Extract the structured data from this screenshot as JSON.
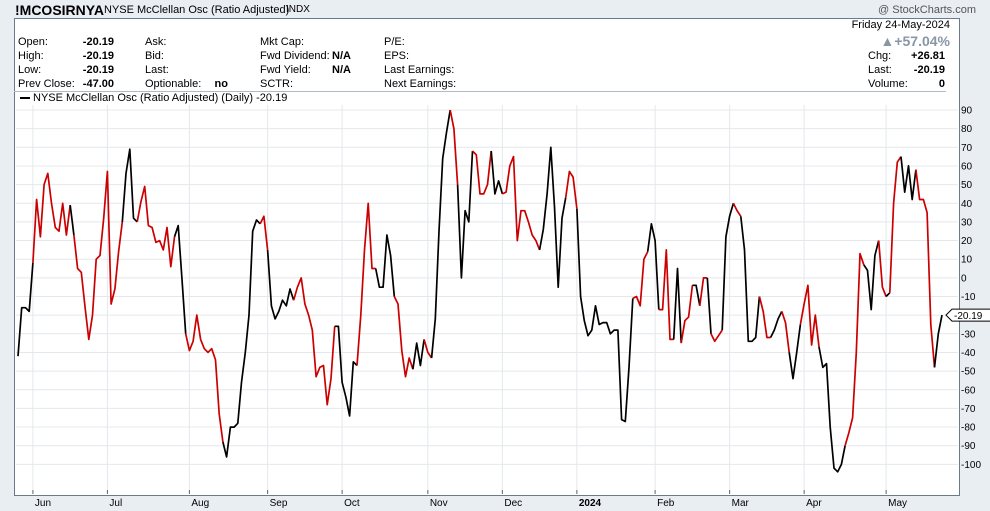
{
  "header": {
    "symbol": "!MCOSIRNYA",
    "name": "NYSE McClellan Osc (Ratio Adjusted)",
    "exchange": "INDX",
    "watermark": "@ StockCharts.com",
    "date": "Friday  24-May-2024",
    "pct_change": "▲+57.04%"
  },
  "quote": {
    "open_label": "Open:",
    "open": "-20.19",
    "high_label": "High:",
    "high": "-20.19",
    "low_label": "Low:",
    "low": "-20.19",
    "prevclose_label": "Prev Close:",
    "prevclose": "-47.00",
    "ask_label": "Ask:",
    "bid_label": "Bid:",
    "last_label": "Last:",
    "optionable_label": "Optionable:",
    "optionable": "no",
    "mktcap_label": "Mkt Cap:",
    "fwddiv_label": "Fwd Dividend:",
    "fwddiv": "N/A",
    "fwdyield_label": "Fwd Yield:",
    "fwdyield": "N/A",
    "sctr_label": "SCTR:",
    "pe_label": "P/E:",
    "eps_label": "EPS:",
    "lastearn_label": "Last Earnings:",
    "nextearn_label": "Next Earnings:",
    "chg_label": "Chg:",
    "chg": "+26.81",
    "last2_label": "Last:",
    "last2": "-20.19",
    "volume_label": "Volume:",
    "volume": "0"
  },
  "legend": {
    "text": "NYSE McClellan Osc (Ratio Adjusted) (Daily) -20.19"
  },
  "colors": {
    "up": "#000000",
    "down": "#cc0000",
    "marker_border": "#000000"
  },
  "chart_data": {
    "type": "line",
    "ylim": [
      -105,
      97
    ],
    "yticks": [
      90,
      80,
      70,
      60,
      50,
      40,
      30,
      20,
      10,
      0,
      -10,
      -20,
      -30,
      -40,
      -50,
      -60,
      -70,
      -80,
      -90,
      -100
    ],
    "month_ticks": [
      {
        "label": "Jun",
        "i": 4
      },
      {
        "label": "Jul",
        "i": 24
      },
      {
        "label": "Aug",
        "i": 46
      },
      {
        "label": "Sep",
        "i": 67
      },
      {
        "label": "Oct",
        "i": 87
      },
      {
        "label": "Nov",
        "i": 110
      },
      {
        "label": "Dec",
        "i": 130
      },
      {
        "label": "2024",
        "i": 150
      },
      {
        "label": "Feb",
        "i": 171
      },
      {
        "label": "Mar",
        "i": 191
      },
      {
        "label": "Apr",
        "i": 211
      },
      {
        "label": "May",
        "i": 233
      }
    ],
    "last_value": "-20.19",
    "values": [
      -42,
      -16,
      -16,
      -18,
      8,
      42,
      22,
      50,
      56,
      40,
      27,
      25,
      40,
      23,
      39,
      23,
      5,
      3,
      -16,
      -33,
      -20,
      10,
      12,
      32,
      57,
      -14,
      -6,
      14,
      30,
      56,
      69,
      32,
      30,
      41,
      49,
      28,
      27,
      19,
      20,
      15,
      27,
      6,
      22,
      28,
      0,
      -30,
      -39,
      -34,
      -20,
      -33,
      -38,
      -40,
      -38,
      -44,
      -73,
      -88,
      -96,
      -80,
      -80,
      -78,
      -56,
      -40,
      -20,
      25,
      31,
      29,
      33,
      15,
      -15,
      -22,
      -18,
      -12,
      -15,
      -6,
      -12,
      -5,
      0,
      -14,
      -20,
      -28,
      -53,
      -48,
      -47,
      -68,
      -54,
      -26,
      -26,
      -56,
      -64,
      -74,
      -45,
      -47,
      -20,
      15,
      40,
      5,
      5,
      -5,
      -5,
      23,
      12,
      -10,
      -14,
      -39,
      -53,
      -43,
      -49,
      -35,
      -47,
      -33,
      -40,
      -43,
      -22,
      25,
      64,
      78,
      90,
      80,
      50,
      0,
      36,
      30,
      68,
      66,
      45,
      45,
      50,
      68,
      45,
      52,
      45,
      46,
      60,
      65,
      20,
      36,
      36,
      30,
      23,
      20,
      15,
      26,
      45,
      70,
      38,
      -5,
      32,
      43,
      57,
      54,
      37,
      -10,
      -23,
      -31,
      -28,
      -15,
      -25,
      -24,
      -24,
      -30,
      -28,
      -28,
      -76,
      -77,
      -48,
      -11,
      -10,
      -15,
      10,
      14,
      29,
      20,
      -17,
      -17,
      15,
      -33,
      -33,
      5,
      -35,
      -23,
      -21,
      -4,
      -4,
      -15,
      0,
      0,
      -30,
      -34,
      -31,
      -28,
      22,
      33,
      40,
      36,
      33,
      15,
      -34,
      -34,
      -32,
      -10,
      -18,
      -32,
      -32,
      -28,
      -22,
      -18,
      -24,
      -40,
      -54,
      -40,
      -25,
      -14,
      -4,
      -36,
      -20,
      -37,
      -48,
      -46,
      -80,
      -102,
      -104,
      -100,
      -90,
      -83,
      -75,
      -40,
      13,
      7,
      4,
      -17,
      12,
      20,
      -5,
      -10,
      -8,
      40,
      62,
      65,
      46,
      60,
      42,
      58,
      42,
      42,
      35,
      -25,
      -48,
      -30,
      -20
    ],
    "color_runs": [
      [
        "up",
        0
      ],
      [
        "down",
        4
      ],
      [
        "up",
        14
      ],
      [
        "down",
        15
      ],
      [
        "up",
        28
      ],
      [
        "down",
        32
      ],
      [
        "up",
        42
      ],
      [
        "down",
        45
      ],
      [
        "up",
        55
      ],
      [
        "down",
        65
      ],
      [
        "up",
        67
      ],
      [
        "down",
        74
      ],
      [
        "up",
        85
      ],
      [
        "down",
        91
      ],
      [
        "up",
        96
      ],
      [
        "down",
        101
      ],
      [
        "up",
        106
      ],
      [
        "down",
        109
      ],
      [
        "up",
        111
      ],
      [
        "down",
        116
      ],
      [
        "up",
        118
      ],
      [
        "down",
        122
      ],
      [
        "up",
        127
      ],
      [
        "down",
        130
      ],
      [
        "up",
        140
      ],
      [
        "down",
        147
      ],
      [
        "up",
        150
      ],
      [
        "down",
        165
      ],
      [
        "up",
        169
      ],
      [
        "down",
        172
      ],
      [
        "up",
        176
      ],
      [
        "down",
        178
      ],
      [
        "up",
        181
      ],
      [
        "down",
        183
      ],
      [
        "up",
        185
      ],
      [
        "down",
        186
      ],
      [
        "up",
        189
      ],
      [
        "down",
        192
      ],
      [
        "up",
        194
      ],
      [
        "down",
        199
      ],
      [
        "up",
        202
      ],
      [
        "down",
        205
      ],
      [
        "up",
        207
      ],
      [
        "down",
        210
      ],
      [
        "up",
        215
      ],
      [
        "down",
        222
      ],
      [
        "up",
        227
      ],
      [
        "down",
        231
      ],
      [
        "up",
        233
      ],
      [
        "down",
        234
      ],
      [
        "up",
        237
      ],
      [
        "down",
        241
      ],
      [
        "up",
        246
      ]
    ]
  }
}
